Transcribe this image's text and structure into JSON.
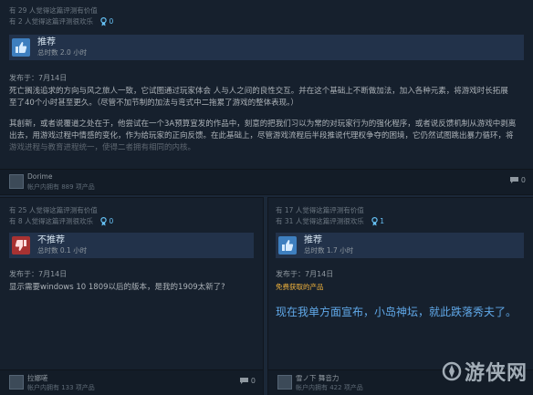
{
  "reviews": [
    {
      "helpful_line": "有 29 人觉得这篇评测有价值",
      "funny_line": "有 2 人觉得这篇评测很欢乐",
      "awards": "0",
      "recommendation": "推荐",
      "hours": "总时数 2.0 小时",
      "date": "发布于：7月14日",
      "body": [
        "死亡搁浅追求的方向与风之旅人一致，它试图通过玩家体会 人与人之间的良性交互。并在这个基础上不断做加法，加入各种元素，将游戏时长拓展",
        "至了40个小时甚至更久。（尽管不加节制的加法与弯式中二拖累了游戏的整体表现。）",
        "",
        "其創新，或者说覆道之处在于，他尝试在一个3A预算宣发的作品中，刻意的把我们习以为常的对玩家行为的强化程序，或者说反馈机制从游戏中剥离",
        "出去，用游戏过程中情感的变化，作为给玩家的正向反馈。在此基础上，尽管游戏流程后半段推说代理权争夺的困境，它仍然试图跳出暴力循环，将",
        "游戏进程与教育进程统一，使得二者拥有相同的内核。"
      ],
      "user": "Dorime",
      "user_products": "帐户内拥有 889 项产品",
      "comments": "0"
    },
    {
      "helpful_line": "有 25 人觉得这篇评测有价值",
      "funny_line": "有 8 人觉得这篇评测很欢乐",
      "awards": "0",
      "recommendation": "不推荐",
      "hours": "总时数 0.1 小时",
      "date": "发布于：7月14日",
      "body": [
        "显示需要windows 10 1809以后的版本，是我的1909太新了?"
      ],
      "user": "拉娜嗟",
      "user_products": "帐户内拥有 133 项产品",
      "comments": "0"
    },
    {
      "helpful_line": "有 17 人觉得这篇评测有价值",
      "funny_line": "有 31 人觉得这篇评测很欢乐",
      "awards": "1",
      "recommendation": "推荐",
      "hours": "总时数 1.7 小时",
      "date": "发布于：7月14日",
      "free_tag": "免费获取的产品",
      "body": [
        "现在我单方面宣布，小岛神坛，就此跌落秀夫了。"
      ],
      "user": "雪ノ下 舞音力",
      "user_products": "帐户内拥有 422 项产品",
      "comments": "0"
    }
  ],
  "watermark": "游侠网",
  "colors": {
    "accent": "#66c0f4",
    "thumb_up": "#3e7fbf",
    "thumb_down": "#a83232"
  }
}
